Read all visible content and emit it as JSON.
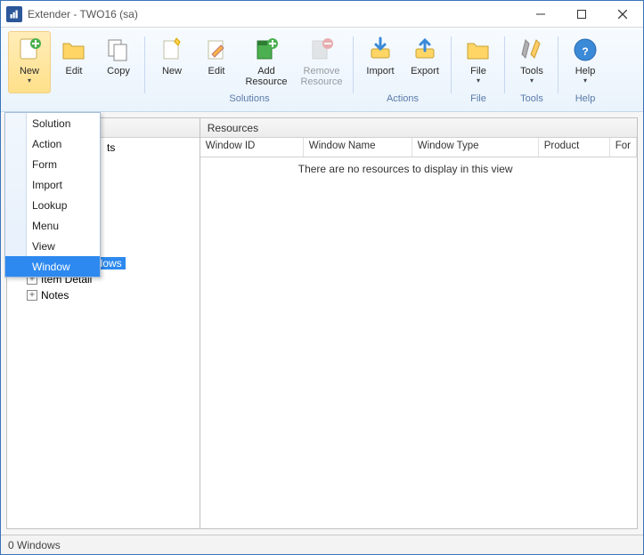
{
  "title": "Extender  -  TWO16 (sa)",
  "ribbon": {
    "new": "New",
    "edit": "Edit",
    "copy": "Copy",
    "s_new": "New",
    "s_edit": "Edit",
    "add_resource": "Add Resource",
    "remove_resource": "Remove Resource",
    "group_solutions": "Solutions",
    "import": "Import",
    "export": "Export",
    "group_actions": "Actions",
    "file": "File",
    "group_file": "File",
    "tools": "Tools",
    "group_tools": "Tools",
    "help": "Help",
    "group_help": "Help"
  },
  "menu": {
    "items": [
      "Solution",
      "Action",
      "Form",
      "Import",
      "Lookup",
      "Menu",
      "View",
      "Window"
    ],
    "highlight_index": 7
  },
  "tree": {
    "visible_partial": "ts",
    "windows": "Windows",
    "item_detail": "Item Detail",
    "notes": "Notes"
  },
  "grid": {
    "title": "Resources",
    "cols": [
      "Window ID",
      "Window Name",
      "Window Type",
      "Product",
      "For"
    ],
    "empty": "There are no resources to display in this view"
  },
  "status": "0 Windows"
}
